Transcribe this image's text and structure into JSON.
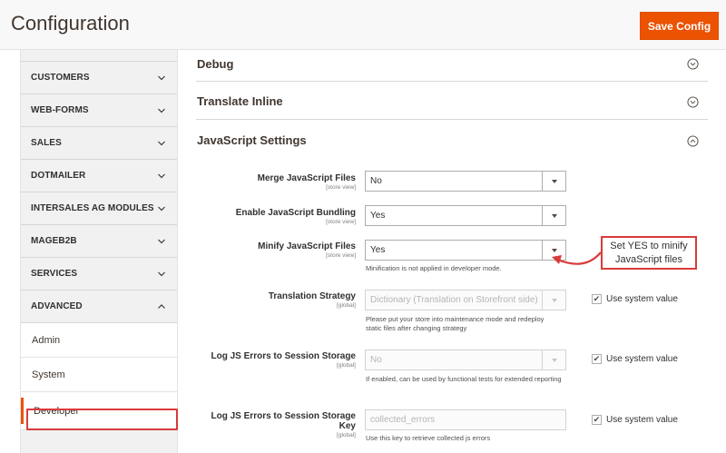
{
  "header": {
    "title": "Configuration",
    "save_label": "Save Config"
  },
  "sidebar": {
    "items": [
      {
        "label": "CUSTOMERS",
        "state": "collapsed"
      },
      {
        "label": "WEB-FORMS",
        "state": "collapsed"
      },
      {
        "label": "SALES",
        "state": "collapsed"
      },
      {
        "label": "DOTMAILER",
        "state": "collapsed"
      },
      {
        "label": "INTERSALES AG MODULES",
        "state": "collapsed"
      },
      {
        "label": "MAGEB2B",
        "state": "collapsed"
      },
      {
        "label": "SERVICES",
        "state": "collapsed"
      },
      {
        "label": "ADVANCED",
        "state": "expanded"
      }
    ],
    "subitems": [
      "Admin",
      "System"
    ],
    "active_subitem": "Developer"
  },
  "sections": {
    "debug": "Debug",
    "translate_inline": "Translate Inline",
    "javascript_settings": "JavaScript Settings"
  },
  "fields": {
    "merge_js": {
      "label": "Merge JavaScript Files",
      "scope": "[store view]",
      "value": "No"
    },
    "enable_bundling": {
      "label": "Enable JavaScript Bundling",
      "scope": "[store view]",
      "value": "Yes"
    },
    "minify_js": {
      "label": "Minify JavaScript Files",
      "scope": "[store view]",
      "value": "Yes",
      "note": "Minification is not applied in developer mode."
    },
    "translation_strategy": {
      "label": "Translation Strategy",
      "scope": "[global]",
      "value": "Dictionary (Translation on Storefront side)",
      "note": "Please put your store into maintenance mode and redeploy static files after changing strategy",
      "use_system_value": "Use system value",
      "checked": true
    },
    "log_js_errors": {
      "label": "Log JS Errors to Session Storage",
      "scope": "[global]",
      "value": "No",
      "note": "If enabled, can be used by functional tests for extended reporting",
      "use_system_value": "Use system value",
      "checked": true
    },
    "log_js_errors_key": {
      "label": "Log JS Errors to Session Storage Key",
      "scope": "[global]",
      "value": "collected_errors",
      "note": "Use this key to retrieve collected js errors",
      "use_system_value": "Use system value",
      "checked": true
    }
  },
  "callout": {
    "text": "Set YES to minify JavaScript files"
  },
  "icons": {
    "chevron": "chevron-down-icon",
    "chevron_up": "chevron-up-icon",
    "section_toggle": "circle-chevron-icon",
    "checkmark": "✔"
  },
  "colors": {
    "accent": "#eb5202",
    "annotation_red": "#d93b3b"
  }
}
